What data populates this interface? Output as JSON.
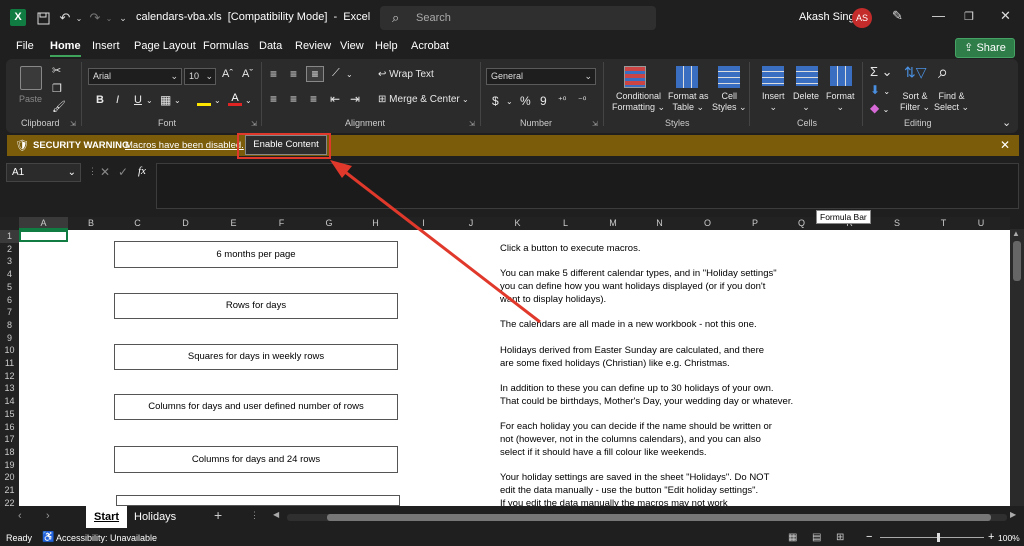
{
  "app": {
    "filename": "calendars-vba.xls",
    "mode": "[Compatibility Mode]",
    "dash": "-",
    "appname": "Excel",
    "search_placeholder": "Search",
    "user_name": "Akash Singh",
    "user_initials": "AS",
    "excel_logo": "X"
  },
  "menu": [
    "File",
    "Home",
    "Insert",
    "Page Layout",
    "Formulas",
    "Data",
    "Review",
    "View",
    "Help",
    "Acrobat"
  ],
  "share_label": "Share",
  "ribbon": {
    "paste": "Paste",
    "font_name": "Arial",
    "font_size": "10",
    "wrap_text": "Wrap Text",
    "merge_center": "Merge & Center",
    "number_format": "General",
    "cond_formatting": [
      "Conditional",
      "Formatting"
    ],
    "format_table": [
      "Format as",
      "Table"
    ],
    "cell_styles": [
      "Cell",
      "Styles"
    ],
    "insert": "Insert",
    "delete": "Delete",
    "format": "Format",
    "sort_filter": [
      "Sort &",
      "Filter"
    ],
    "find_select": [
      "Find &",
      "Select"
    ],
    "groups": [
      "Clipboard",
      "Font",
      "Alignment",
      "Number",
      "Styles",
      "Cells",
      "Editing"
    ],
    "bold": "B",
    "italic": "I",
    "underline": "U",
    "dollar": "$",
    "percent": "%",
    "comma": "9"
  },
  "security": {
    "label": "SECURITY WARNING",
    "message": "Macros have been disabled.",
    "button": "Enable Content"
  },
  "formula_bar": {
    "namebox": "A1",
    "fx": "fx",
    "tooltip": "Formula Bar"
  },
  "columns": [
    "A",
    "B",
    "C",
    "D",
    "E",
    "F",
    "G",
    "H",
    "I",
    "J",
    "K",
    "L",
    "M",
    "N",
    "O",
    "P",
    "Q",
    "R",
    "S",
    "T",
    "U"
  ],
  "rows": [
    "1",
    "2",
    "3",
    "4",
    "5",
    "6",
    "7",
    "8",
    "9",
    "10",
    "11",
    "12",
    "13",
    "14",
    "15",
    "16",
    "17",
    "18",
    "19",
    "20",
    "21",
    "22"
  ],
  "buttons": [
    "6 months per page",
    "Rows for days",
    "Squares for days in weekly rows",
    "Columns for days and user defined number of rows",
    "Columns for days and 24 rows"
  ],
  "text_lines": [
    "Click a button to execute macros.",
    "You can make 5 different calendar types, and in \"Holiday settings\"",
    "you can define how you want holidays displayed (or if you don't",
    "want to display holidays).",
    "The calendars are all made in a new workbook - not this one.",
    "Holidays derived from Easter Sunday are calculated, and there",
    "are some fixed holidays (Christian) like e.g. Christmas.",
    "In addition to these you can define up to 30 holidays of your own.",
    "That could be birthdays, Mother's Day, your wedding day or whatever.",
    "For each holiday you can decide if the name should be written or",
    "not (however, not in the columns calendars), and you can also",
    "select if it should have a fill colour like weekends.",
    "Your holiday settings are saved in the sheet \"Holidays\". Do NOT",
    "edit the data manually - use the button \"Edit holiday settings\".",
    "If you edit the data manually the macros may not work"
  ],
  "sheets": [
    "Start",
    "Holidays"
  ],
  "status": {
    "ready": "Ready",
    "accessibility": "Accessibility: Unavailable",
    "zoom": "100%"
  },
  "colors": {
    "excel_green": "#107c41",
    "warning_bar": "#7b5c0a",
    "highlight": "#e0392b",
    "share_green": "#2f7d49"
  }
}
